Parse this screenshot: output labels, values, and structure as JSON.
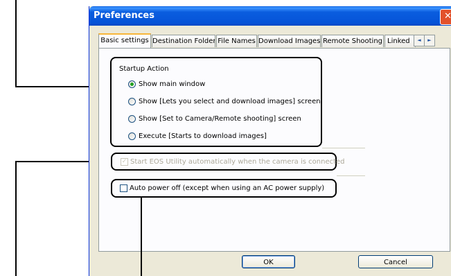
{
  "window": {
    "title": "Preferences",
    "close_symbol": "✕"
  },
  "tabs": [
    {
      "label": "Basic settings",
      "active": true
    },
    {
      "label": "Destination Folder",
      "active": false
    },
    {
      "label": "File Names",
      "active": false
    },
    {
      "label": "Download Images",
      "active": false
    },
    {
      "label": "Remote Shooting",
      "active": false
    },
    {
      "label": "Linked",
      "active": false
    }
  ],
  "tab_scroll": {
    "left_icon": "◄",
    "right_icon": "►"
  },
  "startup_action": {
    "title": "Startup Action",
    "options": [
      {
        "label": "Show main window",
        "selected": true
      },
      {
        "label": "Show [Lets you select and download images] screen",
        "selected": false
      },
      {
        "label": "Show [Set to Camera/Remote shooting] screen",
        "selected": false
      },
      {
        "label": "Execute [Starts to download images]",
        "selected": false
      }
    ]
  },
  "auto_start": {
    "label": "Start EOS Utility automatically when the camera is connected",
    "checked": true,
    "enabled": false,
    "check_symbol": "✓"
  },
  "auto_power_off": {
    "label": "Auto power off (except when using an AC power supply)",
    "checked": false
  },
  "buttons": {
    "ok": "OK",
    "cancel": "Cancel"
  },
  "colors": {
    "titlebar": "#0a5ddf",
    "close_button": "#e2512b",
    "active_tab_highlight": "#f8b63a",
    "radio_dot": "#21a121",
    "disabled_text": "#aca899"
  }
}
